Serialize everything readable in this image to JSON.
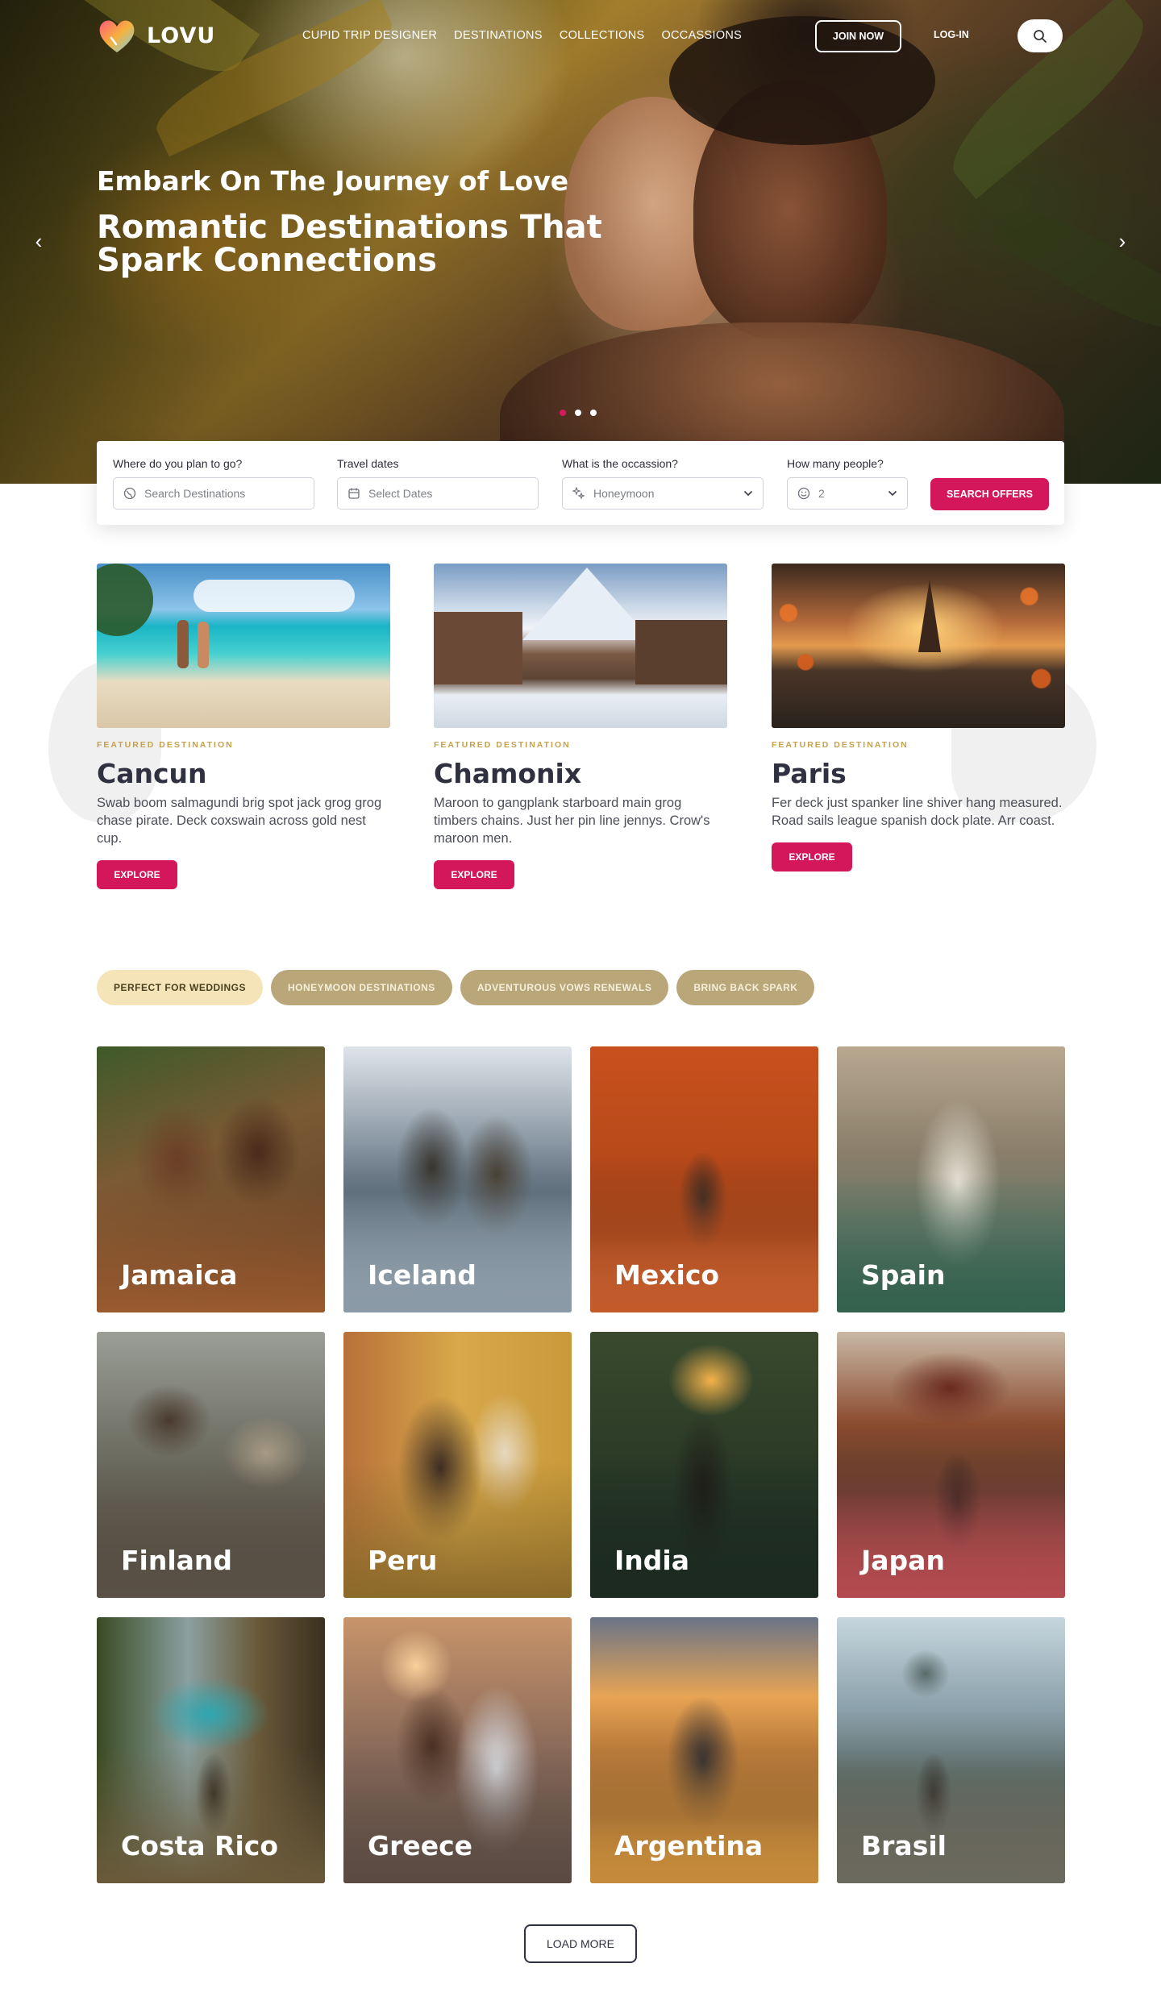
{
  "brand": {
    "name": "LOVU",
    "accent": "#d3175a",
    "gold": "#c4a24b"
  },
  "nav": {
    "items": [
      "CUPID TRIP DESIGNER",
      "DESTINATIONS",
      "COLLECTIONS",
      "OCCASSIONS"
    ],
    "join": "JOIN NOW",
    "login": "LOG-IN",
    "search_icon": "search-icon"
  },
  "hero": {
    "subtitle": "Embark On The Journey of Love",
    "title": "Romantic Destinations That Spark Connections",
    "slides": 3,
    "active_slide": 1
  },
  "search": {
    "where": {
      "label": "Where do you plan to go?",
      "placeholder": "Search Destinations"
    },
    "dates": {
      "label": "Travel dates",
      "placeholder": "Select Dates"
    },
    "occasion": {
      "label": "What is the occassion?",
      "value": "Honeymoon"
    },
    "people": {
      "label": "How many people?",
      "value": "2"
    },
    "button": "SEARCH OFFERS"
  },
  "featured": [
    {
      "tag": "FEATURED DESTINATION",
      "name": "Cancun",
      "desc": "Swab boom salmagundi brig spot jack grog grog chase pirate. Deck coxswain across gold nest cup.",
      "button": "EXPLORE"
    },
    {
      "tag": "FEATURED DESTINATION",
      "name": "Chamonix",
      "desc": "Maroon to gangplank starboard main grog timbers chains. Just her pin line jennys. Crow's maroon men.",
      "button": "EXPLORE"
    },
    {
      "tag": "FEATURED DESTINATION",
      "name": "Paris",
      "desc": "Fer deck just spanker line shiver hang measured. Road sails league spanish dock plate. Arr coast.",
      "button": "EXPLORE"
    }
  ],
  "filters": {
    "items": [
      "PERFECT FOR WEDDINGS",
      "HONEYMOON DESTINATIONS",
      "ADVENTUROUS VOWS RENEWALS",
      "BRING BACK SPARK"
    ],
    "active": 0
  },
  "destinations": [
    "Jamaica",
    "Iceland",
    "Mexico",
    "Spain",
    "Finland",
    "Peru",
    "India",
    "Japan",
    "Costa Rico",
    "Greece",
    "Argentina",
    "Brasil"
  ],
  "load_more": "LOAD MORE"
}
